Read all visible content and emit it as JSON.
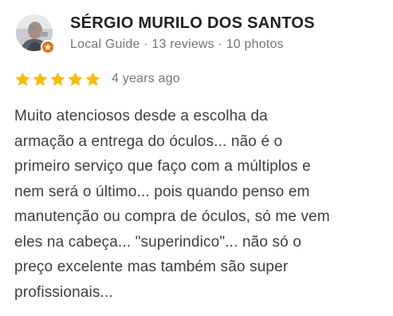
{
  "review": {
    "author": {
      "name": "SÉRGIO MURILO DOS SANTOS",
      "meta": "Local Guide · 13 reviews · 10 photos",
      "badge_color": "#e8710a",
      "avatar_icon": "user-photo-avatar"
    },
    "rating": {
      "stars": 5,
      "max_stars": 5,
      "star_color": "#fbbc04",
      "date": "4 years ago"
    },
    "text": "Muito atenciosos desde a escolha da\narmação a entrega do óculos... não é o\nprimeiro serviço que faço com a múltiplos e\nnem será o último... pois quando penso em\nmanutenção ou compra de óculos, só me vem\neles na cabeça... \"superindico\"... não só o\npreço excelente mas também são super\nprofissionais..."
  }
}
